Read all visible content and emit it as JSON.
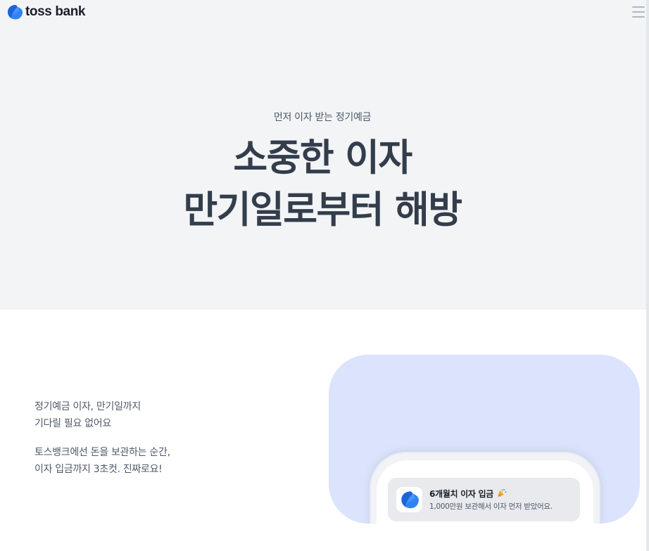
{
  "header": {
    "logo_text": "toss bank",
    "logo_icon": "toss-bank-logo-icon",
    "menu_icon": "hamburger-menu-icon"
  },
  "hero": {
    "eyebrow": "먼저 이자 받는 정기예금",
    "title_line1": "소중한 이자",
    "title_line2": "만기일로부터 해방"
  },
  "feature": {
    "desc1_line1": "정기예금 이자, 만기일까지",
    "desc1_line2": "기다릴 필요 없어요",
    "desc2_line1": "토스뱅크에선 돈을 보관하는 순간,",
    "desc2_line2": "이자 입금까지 3초컷. 진짜로요!"
  },
  "notification": {
    "title": "6개월치 이자 입금",
    "emoji_icon": "party-popper-icon",
    "body": "1,000만원 보관해서 이자 먼저 받았어요."
  },
  "colors": {
    "hero_bg": "#f2f4f6",
    "text_dark": "#333d4b",
    "text_gray": "#4e5968",
    "visual_bg": "#dbe4fc",
    "brand_blue": "#3182f6"
  }
}
